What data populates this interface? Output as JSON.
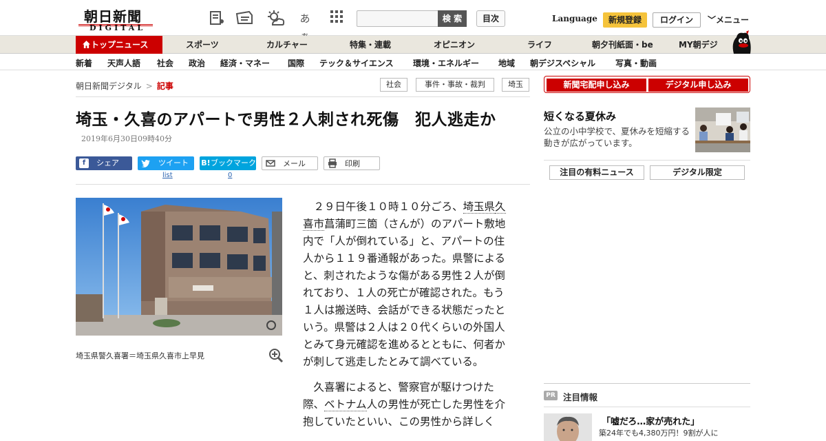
{
  "header": {
    "logo_main": "朝日新聞",
    "logo_sub": "DIGITAL",
    "search_button": "検 索",
    "index_button": "目次",
    "language": "Language",
    "register": "新規登録",
    "login": "ログイン",
    "menu": "メニュー",
    "icon_kana": "あぁ"
  },
  "nav_primary": [
    "トップニュース",
    "スポーツ",
    "カルチャー",
    "特集・連載",
    "オピニオン",
    "ライフ",
    "朝夕刊紙面・be",
    "MY朝デジ"
  ],
  "nav_secondary": [
    "新着",
    "天声人語",
    "社会",
    "政治",
    "経済・マネー",
    "国際",
    "テック＆サイエンス",
    "環境・エネルギー",
    "地域",
    "朝デジスペシャル",
    "写真・動画"
  ],
  "breadcrumb": {
    "home": "朝日新聞デジタル",
    "separator": ">",
    "current": "記事"
  },
  "tags": [
    "社会",
    "事件・事故・裁判",
    "埼玉"
  ],
  "article": {
    "title": "埼玉・久喜のアパートで男性２人刺され死傷　犯人逃走か",
    "date": "2019年6月30日09時40分",
    "caption": "埼玉県警久喜署＝埼玉県久喜市上早見",
    "p1_a": "２９日午後１０時１０分ごろ、",
    "p1_link1": "埼玉県",
    "p1_link2": "久喜市",
    "p1_b": "菖蒲町三箇（さんが）のアパート敷地内で「人が倒れている」と、アパートの住人から１１９番通報があった。県警によると、刺されたような傷がある男性２人が倒れており、１人の死亡が確認された。もう１人は搬送時、会話ができる状態だったという。県警は２人は２０代くらいの外国人とみて身元確認を進めるとともに、何者かが刺して逃走したとみて調べている。",
    "p2_a": "久喜署によると、警察官が駆けつけた際、",
    "p2_link": "ベトナム",
    "p2_b": "人の男性が死亡した男性を介抱していたといい、この男性から詳しく"
  },
  "share": {
    "facebook": "シェア",
    "twitter": "ツイート",
    "hatena": "ブックマーク",
    "hatena_icon": "B!",
    "mail": "メール",
    "print": "印刷",
    "twitter_count": "list",
    "hatena_count": "0"
  },
  "sidebar": {
    "subscribe_paper": "新聞宅配申し込み",
    "subscribe_digital": "デジタル申し込み",
    "feature_title": "短くなる夏休み",
    "feature_desc": "公立の小中学校で、夏休みを短縮する動きが広がっています。",
    "tab_paid": "注目の有料ニュース",
    "tab_digital": "デジタル限定",
    "pr_badge": "PR",
    "pr_label": "注目情報",
    "ad_title": "「嘘だろ…家が売れた」",
    "ad_sub": "築24年でも4,380万円！9割が人に"
  },
  "colors": {
    "brand_red": "#cc0000",
    "nav_bg": "#eae7de",
    "register_yellow": "#f5c33b",
    "facebook": "#3b5998",
    "twitter": "#1da1f2",
    "hatena": "#00a4de"
  }
}
